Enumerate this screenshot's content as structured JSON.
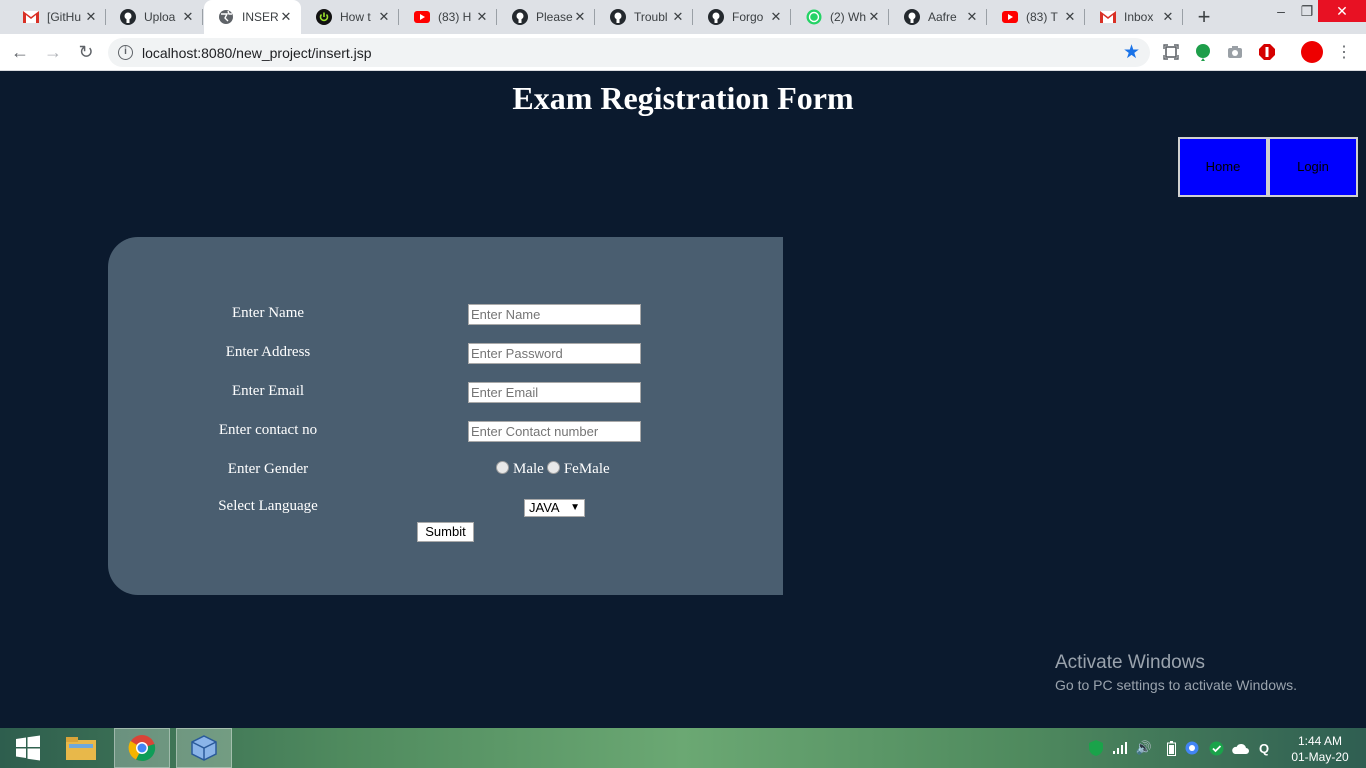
{
  "browser": {
    "tabs": [
      {
        "title": "[GitHu",
        "icon": "gmail-icon",
        "active": false
      },
      {
        "title": "Uploa",
        "icon": "github-icon",
        "active": false
      },
      {
        "title": "INSER",
        "icon": "globe-icon",
        "active": true
      },
      {
        "title": "How t",
        "icon": "power-icon",
        "active": false
      },
      {
        "title": "(83) H",
        "icon": "youtube-icon",
        "active": false
      },
      {
        "title": "Please",
        "icon": "github-icon",
        "active": false
      },
      {
        "title": "Troubl",
        "icon": "github-icon",
        "active": false
      },
      {
        "title": "Forgo",
        "icon": "github-icon",
        "active": false
      },
      {
        "title": "(2) Wh",
        "icon": "whatsapp-icon",
        "active": false
      },
      {
        "title": "Aafre",
        "icon": "github-icon",
        "active": false
      },
      {
        "title": "(83) T",
        "icon": "youtube-icon",
        "active": false
      },
      {
        "title": "Inbox",
        "icon": "gmail-icon",
        "active": false
      }
    ],
    "url": "localhost:8080/new_project/insert.jsp"
  },
  "page": {
    "title": "Exam Registration Form",
    "nav": {
      "home": "Home",
      "login": "Login"
    },
    "form": {
      "name_label": "Enter Name",
      "name_placeholder": "Enter Name",
      "address_label": "Enter Address",
      "address_placeholder": "Enter Password",
      "email_label": "Enter Email",
      "email_placeholder": "Enter Email",
      "contact_label": "Enter contact no",
      "contact_placeholder": "Enter Contact number",
      "gender_label": "Enter Gender",
      "gender_male": "Male",
      "gender_female": "FeMale",
      "language_label": "Select Language",
      "language_selected": "JAVA",
      "submit_label": "Sumbit"
    }
  },
  "watermark": {
    "line1": "Activate Windows",
    "line2": "Go to PC settings to activate Windows."
  },
  "taskbar": {
    "time": "1:44 AM",
    "date": "01-May-20"
  },
  "colors": {
    "page_bg": "#0b1a2e",
    "panel_bg": "#4a5e70",
    "nav_bg": "#0000ff"
  }
}
